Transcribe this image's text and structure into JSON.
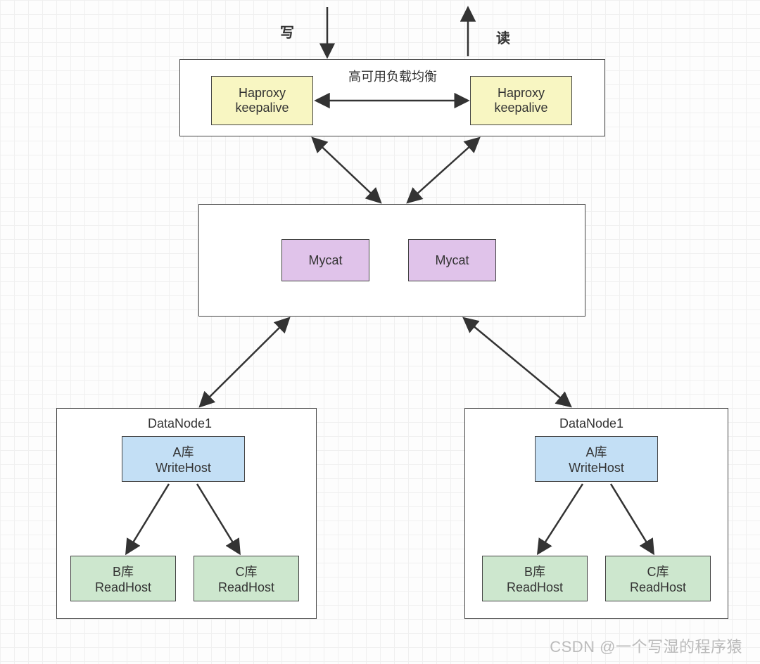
{
  "labels": {
    "write": "写",
    "read": "读",
    "ha_lb": "高可用负载均衡"
  },
  "haproxy": {
    "left": {
      "line1": "Haproxy",
      "line2": "keepalive"
    },
    "right": {
      "line1": "Haproxy",
      "line2": "keepalive"
    }
  },
  "mycat": {
    "left": "Mycat",
    "right": "Mycat"
  },
  "datanode": {
    "left": {
      "title": "DataNode1",
      "write": {
        "line1": "A库",
        "line2": "WriteHost"
      },
      "readB": {
        "line1": "B库",
        "line2": "ReadHost"
      },
      "readC": {
        "line1": "C库",
        "line2": "ReadHost"
      }
    },
    "right": {
      "title": "DataNode1",
      "write": {
        "line1": "A库",
        "line2": "WriteHost"
      },
      "readB": {
        "line1": "B库",
        "line2": "ReadHost"
      },
      "readC": {
        "line1": "C库",
        "line2": "ReadHost"
      }
    }
  },
  "watermark": "CSDN @一个写湿的程序猿"
}
